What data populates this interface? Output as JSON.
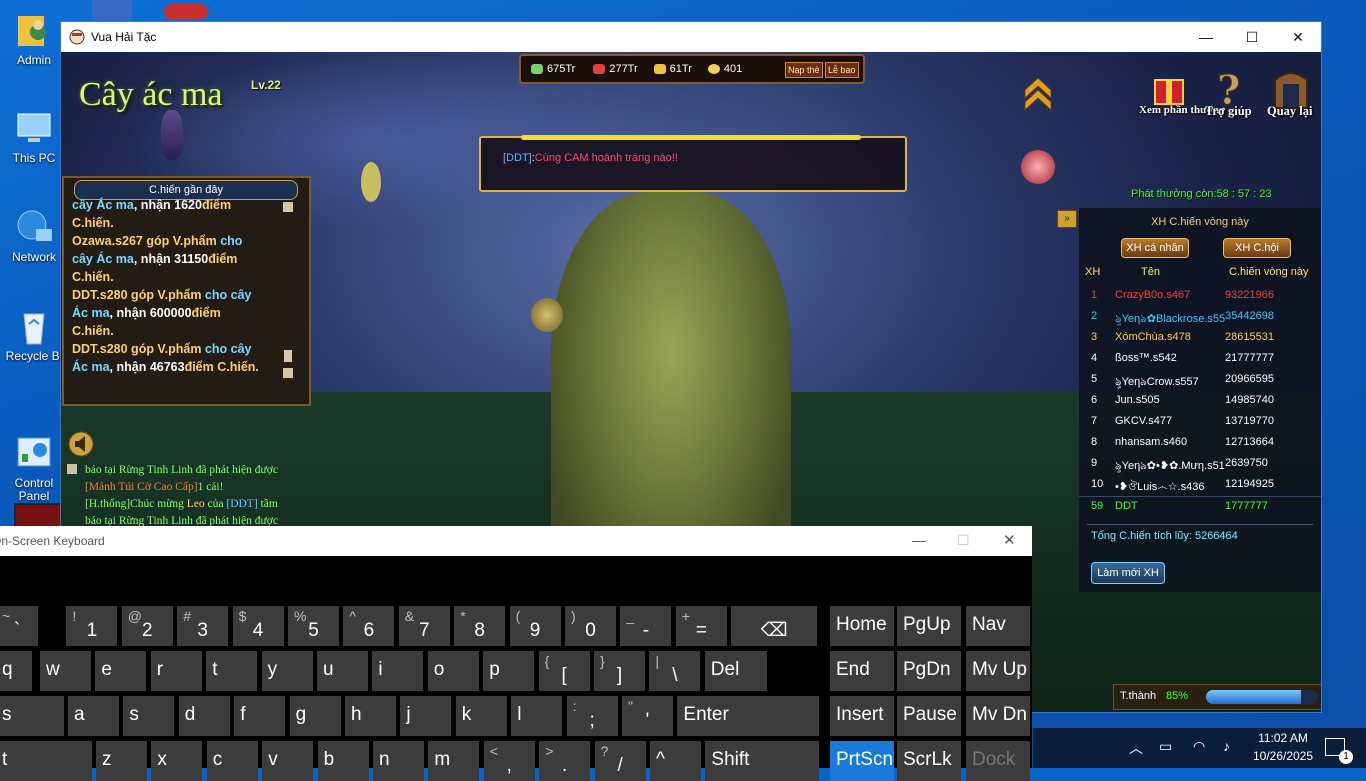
{
  "desktop": {
    "icons": [
      {
        "label": "Admin",
        "icon": "user-folder-icon"
      },
      {
        "label": "This PC",
        "icon": "computer-icon"
      },
      {
        "label": "Network",
        "icon": "network-icon"
      },
      {
        "label": "Recycle Bi",
        "icon": "recycle-bin-icon"
      },
      {
        "label": "Control\nPanel",
        "icon": "control-panel-icon"
      }
    ]
  },
  "window": {
    "title": "Vua Hải Tặc",
    "controls": {
      "minimize": "—",
      "maximize": "☐",
      "close": "✕"
    }
  },
  "game": {
    "title": "Cây ác ma",
    "level": "Lv.22",
    "resources": [
      {
        "value": "675Tr",
        "color": "#7ad06a"
      },
      {
        "value": "277Tr",
        "color": "#e04040"
      },
      {
        "value": "61Tr",
        "color": "#f0c040"
      },
      {
        "value": "401",
        "color": "#f0d060"
      }
    ],
    "topup_label": "Nạp thẻ",
    "gift_label": "Lễ bao",
    "chat_tag": "[DDT]",
    "chat_text": "Cùng CAM hoành tráng nào!!",
    "buttons": {
      "reward_view": "Xem phần thưởng",
      "help": "Trợ giúp",
      "back": "Quay lại"
    },
    "recent_panel": {
      "header": "C.hiến gần đây",
      "entries": [
        {
          "parts": [
            {
              "t": "cây Ác ma",
              "c": "#7ad8ff"
            },
            {
              "t": ", nhận ",
              "c": "#fff"
            },
            {
              "t": "1620",
              "c": "#fff"
            },
            {
              "t": "điểm",
              "c": "#ffd070"
            }
          ]
        },
        {
          "parts": [
            {
              "t": "C.hiến.",
              "c": "#ffd070"
            }
          ]
        },
        {
          "parts": [
            {
              "t": "Ozawa.s267 góp V.phẩm ",
              "c": "#ffd070"
            },
            {
              "t": "cho",
              "c": "#7ad8ff"
            }
          ]
        },
        {
          "parts": [
            {
              "t": "cây Ác ma",
              "c": "#7ad8ff"
            },
            {
              "t": ", nhận ",
              "c": "#fff"
            },
            {
              "t": "31150",
              "c": "#fff"
            },
            {
              "t": "điểm",
              "c": "#ffd070"
            }
          ]
        },
        {
          "parts": [
            {
              "t": "C.hiến.",
              "c": "#ffd070"
            }
          ]
        },
        {
          "parts": [
            {
              "t": "DDT.s280 góp V.phẩm ",
              "c": "#ffd070"
            },
            {
              "t": "cho cây",
              "c": "#7ad8ff"
            }
          ]
        },
        {
          "parts": [
            {
              "t": "Ác ma",
              "c": "#7ad8ff"
            },
            {
              "t": ", nhận ",
              "c": "#fff"
            },
            {
              "t": "600000",
              "c": "#fff"
            },
            {
              "t": "điểm",
              "c": "#ffd070"
            }
          ]
        },
        {
          "parts": [
            {
              "t": "C.hiến.",
              "c": "#ffd070"
            }
          ]
        },
        {
          "parts": [
            {
              "t": "DDT.s280 góp V.phẩm ",
              "c": "#ffd070"
            },
            {
              "t": "cho cây",
              "c": "#7ad8ff"
            }
          ]
        },
        {
          "parts": [
            {
              "t": "Ác ma",
              "c": "#7ad8ff"
            },
            {
              "t": ", nhận ",
              "c": "#fff"
            },
            {
              "t": "46763",
              "c": "#fff"
            },
            {
              "t": "điểm C.hiến.",
              "c": "#ffd070"
            }
          ]
        }
      ]
    },
    "feed": [
      {
        "parts": [
          {
            "t": "báo tại Rừng Tinh Linh đã phát hiện được",
            "c": "#8aff6a"
          }
        ]
      },
      {
        "parts": [
          {
            "t": "[Mảnh Túi Cờ Cao Cấp]",
            "c": "#ff7a3a"
          },
          {
            "t": "1 cái!",
            "c": "#8aff6a"
          }
        ]
      },
      {
        "parts": [
          {
            "t": "[H.thống]",
            "c": "#8aff6a"
          },
          {
            "t": "Chúc mừng ",
            "c": "#8aff6a"
          },
          {
            "t": "Leo",
            "c": "#ffd070"
          },
          {
            "t": " của ",
            "c": "#8aff6a"
          },
          {
            "t": "[DDT]",
            "c": "#6ac8ff"
          },
          {
            "t": " tầm",
            "c": "#8aff6a"
          }
        ]
      },
      {
        "parts": [
          {
            "t": "báo tại Rừng Tinh Linh đã phát hiện được",
            "c": "#8aff6a"
          }
        ]
      }
    ],
    "timer_label": "Phát thưởng còn:",
    "timer_value": "58 : 57 : 23",
    "ranking": {
      "title": "XH C.hiến vòng này",
      "tab_personal": "XH cá nhân",
      "tab_guild": "XH C.hội",
      "col_rank": "XH",
      "col_name": "Tên",
      "col_score": "C.hiến vòng này",
      "rows": [
        {
          "rank": "1",
          "name": "CrazyB0o.s467",
          "score": "93221966",
          "color": "#ff3a3a"
        },
        {
          "rank": "2",
          "name": "ৡYeηঌ✿Blackrose.s55",
          "score": "35442698",
          "color": "#40c8ff"
        },
        {
          "rank": "3",
          "name": "XómChùa.s478",
          "score": "28615531",
          "color": "#ffd040"
        },
        {
          "rank": "4",
          "name": "ßoss™.s542",
          "score": "21777777",
          "color": "#ffffff"
        },
        {
          "rank": "5",
          "name": "ৡYeηঌCrow.s557",
          "score": "20966595",
          "color": "#ffffff"
        },
        {
          "rank": "6",
          "name": "Jun.s505",
          "score": "14985740",
          "color": "#ffffff"
        },
        {
          "rank": "7",
          "name": "GKCV.s477",
          "score": "13719770",
          "color": "#ffffff"
        },
        {
          "rank": "8",
          "name": "nhansam.s460",
          "score": "12713664",
          "color": "#ffffff"
        },
        {
          "rank": "9",
          "name": "ৡYeηঌ✿•❥✿.Mưη.s51",
          "score": "2639750",
          "color": "#ffffff"
        },
        {
          "rank": "10",
          "name": "•❥ঔLuis෴☆.s436",
          "score": "12194925",
          "color": "#ffffff"
        },
        {
          "rank": "59",
          "name": "DDT",
          "score": "1777777",
          "color": "#40ff40"
        }
      ],
      "total_label": "Tổng C.hiến tích lũy:",
      "total_value": "5266464",
      "refresh_label": "Làm mới XH"
    },
    "progress_label": "T.thành",
    "progress_value": "85%",
    "progress_fraction": 0.85
  },
  "osk": {
    "title": "On-Screen Keyboard",
    "row1": [
      {
        "sup": "~",
        "main": "`"
      },
      {
        "sup": "!",
        "main": "1"
      },
      {
        "sup": "@",
        "main": "2"
      },
      {
        "sup": "#",
        "main": "3"
      },
      {
        "sup": "$",
        "main": "4"
      },
      {
        "sup": "%",
        "main": "5"
      },
      {
        "sup": "^",
        "main": "6"
      },
      {
        "sup": "&",
        "main": "7"
      },
      {
        "sup": "*",
        "main": "8"
      },
      {
        "sup": "(",
        "main": "9"
      },
      {
        "sup": ")",
        "main": "0"
      },
      {
        "sup": "_",
        "main": "-"
      },
      {
        "sup": "+",
        "main": "="
      },
      {
        "sup": "",
        "main": "⌫"
      }
    ],
    "row2": [
      "q",
      "w",
      "e",
      "r",
      "t",
      "y",
      "u",
      "i",
      "o",
      "p",
      "[",
      "]",
      "\\",
      "Del"
    ],
    "row2_sup": [
      "",
      "",
      "",
      "",
      "",
      "",
      "",
      "",
      "",
      "",
      "{",
      "}",
      "|",
      ""
    ],
    "row3": [
      "s",
      "a",
      "s",
      "d",
      "f",
      "g",
      "h",
      "j",
      "k",
      "l",
      ";",
      "'",
      "Enter"
    ],
    "row3_sup": [
      "",
      "",
      "",
      "",
      "",
      "",
      "",
      "",
      "",
      "",
      ":",
      "\"",
      ""
    ],
    "row4": [
      "t",
      "z",
      "x",
      "c",
      "v",
      "b",
      "n",
      "m",
      ",",
      ".",
      "/",
      "^",
      "Shift"
    ],
    "row4_sup": [
      "",
      "",
      "",
      "",
      "",
      "",
      "",
      "",
      "<",
      ">",
      "?",
      "",
      ""
    ],
    "nav": [
      [
        "Home",
        "PgUp",
        "Nav"
      ],
      [
        "End",
        "PgDn",
        "Mv Up"
      ],
      [
        "Insert",
        "Pause",
        "Mv Dn"
      ],
      [
        "PrtScn",
        "ScrLk",
        "Dock"
      ]
    ]
  },
  "taskbar": {
    "time": "11:02 AM",
    "date": "10/26/2025",
    "notification_count": "1"
  }
}
